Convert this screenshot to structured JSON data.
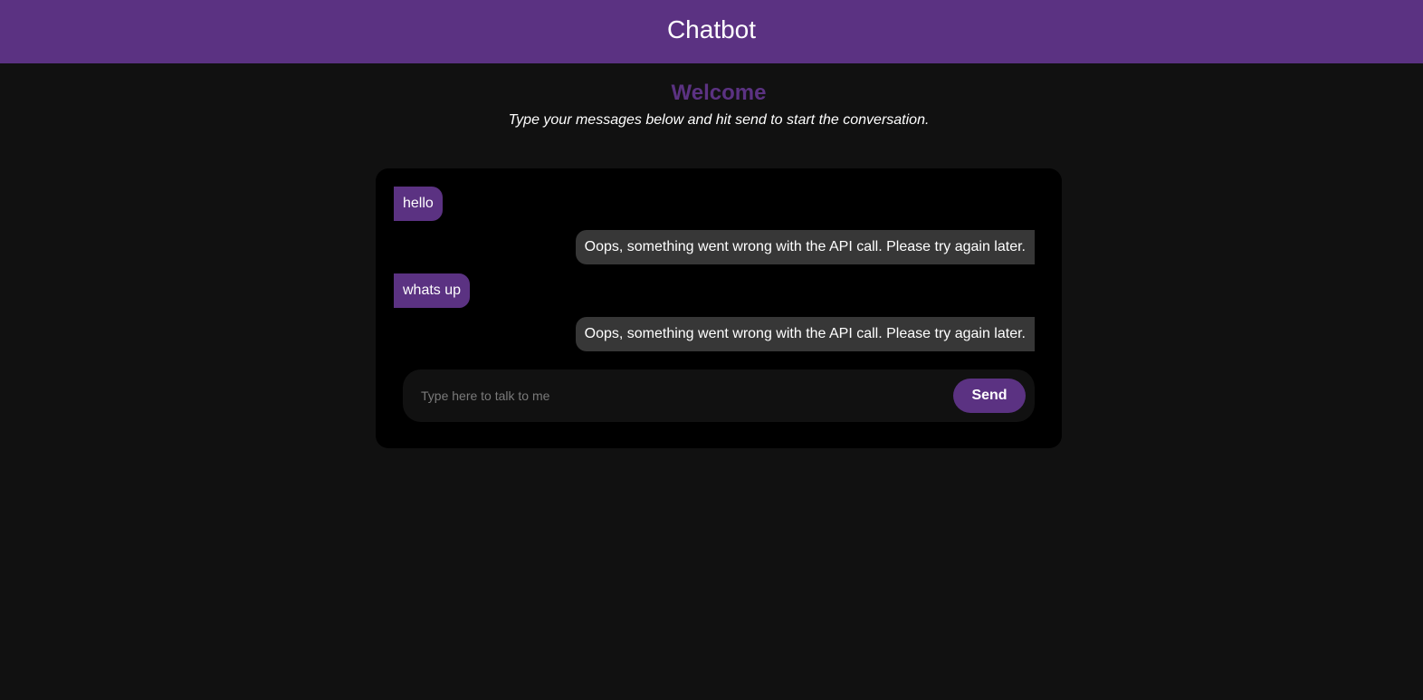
{
  "header": {
    "title": "Chatbot"
  },
  "welcome": {
    "heading": "Welcome",
    "subtitle": "Type your messages below and hit send to start the conversation."
  },
  "messages": [
    {
      "sender": "user",
      "text": "hello"
    },
    {
      "sender": "bot",
      "text": "Oops, something went wrong with the API call. Please try again later."
    },
    {
      "sender": "user",
      "text": "whats up"
    },
    {
      "sender": "bot",
      "text": "Oops, something went wrong with the API call. Please try again later."
    }
  ],
  "input": {
    "value": "",
    "placeholder": "Type here to talk to me",
    "send_label": "Send"
  },
  "colors": {
    "accent": "#5b3282",
    "background": "#111111",
    "chat_background": "#000000",
    "bot_bubble": "#373737"
  }
}
